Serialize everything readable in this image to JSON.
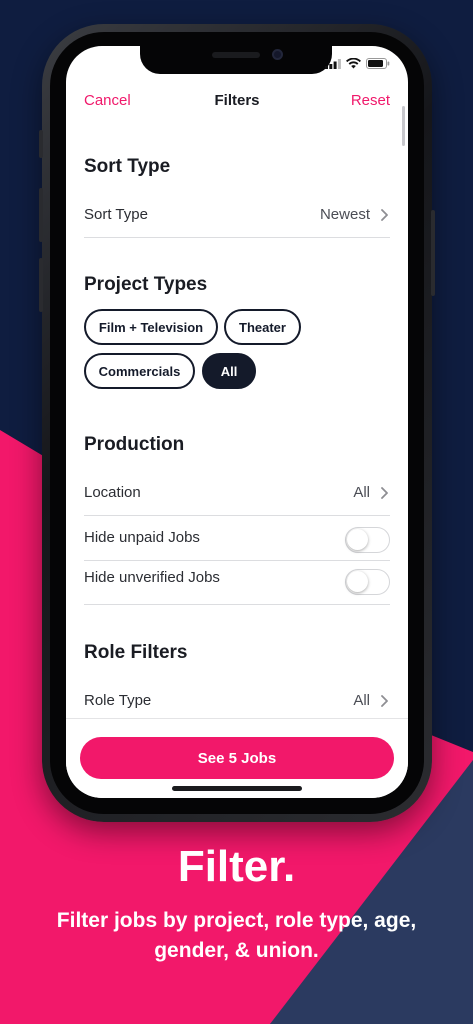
{
  "colors": {
    "background_navy": "#0f1d40",
    "accent_pink": "#f2186a",
    "chip_dark": "#141a2a"
  },
  "nav": {
    "cancel_label": "Cancel",
    "title": "Filters",
    "reset_label": "Reset"
  },
  "sort": {
    "section_title": "Sort Type",
    "row_label": "Sort Type",
    "row_value": "Newest"
  },
  "project_types": {
    "section_title": "Project Types",
    "chips": [
      {
        "label": "Film + Television",
        "selected": false
      },
      {
        "label": "Theater",
        "selected": false
      },
      {
        "label": "Commercials",
        "selected": false
      },
      {
        "label": "All",
        "selected": true
      }
    ]
  },
  "production": {
    "section_title": "Production",
    "location_label": "Location",
    "location_value": "All",
    "hide_unpaid_label": "Hide unpaid Jobs",
    "hide_unpaid_on": false,
    "hide_unverified_label": "Hide unverified Jobs",
    "hide_unverified_on": false
  },
  "role_filters": {
    "section_title": "Role Filters",
    "role_type_label": "Role Type",
    "role_type_value": "All"
  },
  "cta": {
    "label": "See 5 Jobs"
  },
  "promo": {
    "title": "Filter.",
    "subtitle": "Filter jobs by project, role type, age, gender, & union."
  },
  "icons": {
    "chevron": "chevron-right-icon",
    "signal": "signal-icon",
    "wifi": "wifi-icon",
    "battery": "battery-icon"
  }
}
